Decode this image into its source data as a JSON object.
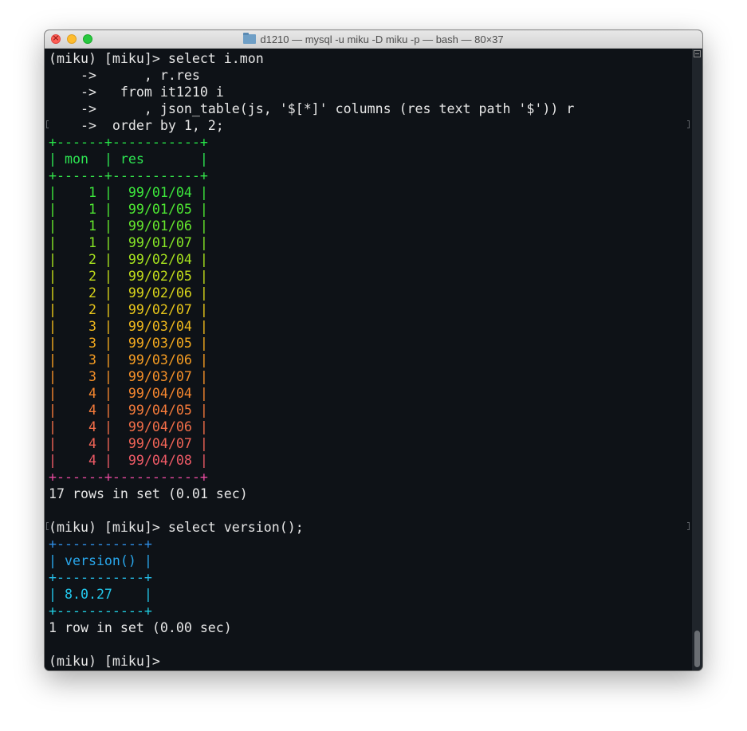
{
  "window": {
    "title": "d1210 — mysql -u miku -D miku -p — bash — 80×37",
    "close_glyph": "×"
  },
  "terminal": {
    "lines": [
      {
        "text": "(miku) [miku]> select i.mon",
        "color": "#e6e6e6"
      },
      {
        "text": "    ->      , r.res",
        "color": "#e6e6e6"
      },
      {
        "text": "    ->   from it1210 i",
        "color": "#e6e6e6"
      },
      {
        "text": "    ->      , json_table(js, '$[*]' columns (res text path '$')) r",
        "color": "#e6e6e6"
      },
      {
        "text": "    ->  order by 1, 2;",
        "color": "#e6e6e6"
      },
      {
        "text": "+------+-----------+",
        "color": "#27e649"
      },
      {
        "text": "| mon  | res       |",
        "color": "#2de552"
      },
      {
        "text": "+------+-----------+",
        "color": "#34e44a"
      },
      {
        "text": "|    1 |  99/01/04 |",
        "color": "#3ce63c"
      },
      {
        "text": "|    1 |  99/01/05 |",
        "color": "#4ee832"
      },
      {
        "text": "|    1 |  99/01/06 |",
        "color": "#66e82c"
      },
      {
        "text": "|    1 |  99/01/07 |",
        "color": "#86e626"
      },
      {
        "text": "|    2 |  99/02/04 |",
        "color": "#a6e21e"
      },
      {
        "text": "|    2 |  99/02/05 |",
        "color": "#c2dc1a"
      },
      {
        "text": "|    2 |  99/02/06 |",
        "color": "#d8d41a"
      },
      {
        "text": "|    2 |  99/02/07 |",
        "color": "#e8c61a"
      },
      {
        "text": "|    3 |  99/03/04 |",
        "color": "#f0b81c"
      },
      {
        "text": "|    3 |  99/03/05 |",
        "color": "#f4aa1e"
      },
      {
        "text": "|    3 |  99/03/06 |",
        "color": "#f59c22"
      },
      {
        "text": "|    3 |  99/03/07 |",
        "color": "#f69028"
      },
      {
        "text": "|    4 |  99/04/04 |",
        "color": "#f5862e"
      },
      {
        "text": "|    4 |  99/04/05 |",
        "color": "#f47a3a"
      },
      {
        "text": "|    4 |  99/04/06 |",
        "color": "#f26e48"
      },
      {
        "text": "|    4 |  99/04/07 |",
        "color": "#f06456"
      },
      {
        "text": "|    4 |  99/04/08 |",
        "color": "#ee5a66"
      },
      {
        "text": "+------+-----------+",
        "color": "#ea4aa0"
      },
      {
        "text": "17 rows in set (0.01 sec)",
        "color": "#e6e6e6"
      },
      {
        "text": "",
        "color": "#e6e6e6"
      },
      {
        "text": "(miku) [miku]> select version();",
        "color": "#e6e6e6"
      },
      {
        "text": "+-----------+",
        "color": "#2f8fe8"
      },
      {
        "text": "| version() |",
        "color": "#29a7ec"
      },
      {
        "text": "+-----------+",
        "color": "#25bde8"
      },
      {
        "text": "| 8.0.27    |",
        "color": "#22c6ea"
      },
      {
        "text": "+-----------+",
        "color": "#20cfe2"
      },
      {
        "text": "1 row in set (0.00 sec)",
        "color": "#e6e6e6"
      },
      {
        "text": "",
        "color": "#e6e6e6"
      },
      {
        "text": "(miku) [miku]>",
        "color": "#e6e6e6"
      }
    ]
  }
}
